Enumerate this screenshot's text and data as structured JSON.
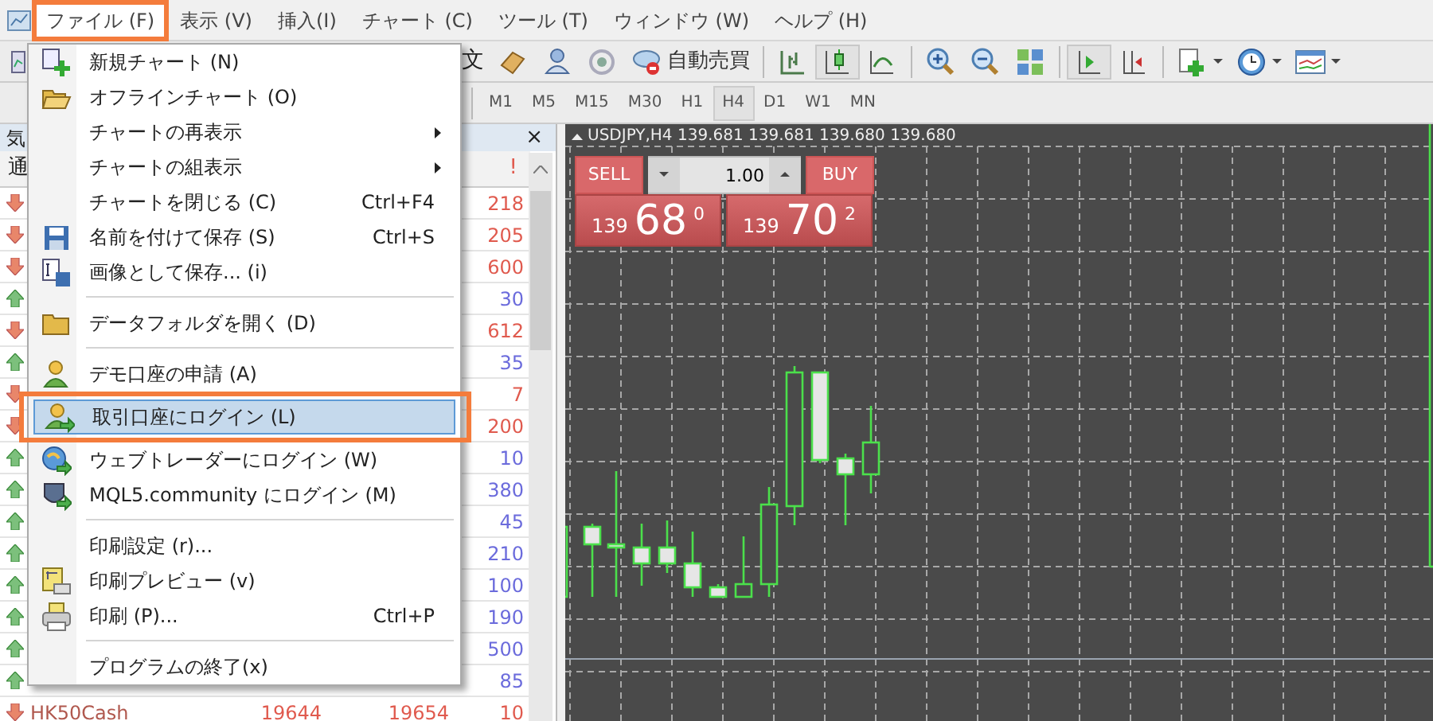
{
  "menubar": {
    "items": [
      {
        "label": "ファイル (F)",
        "selected": true,
        "highlighted": true
      },
      {
        "label": "表示 (V)",
        "selected": false,
        "highlighted": false
      },
      {
        "label": "挿入(I)",
        "selected": false,
        "highlighted": false
      },
      {
        "label": "チャート (C)",
        "selected": false,
        "highlighted": false
      },
      {
        "label": "ツール (T)",
        "selected": false,
        "highlighted": false
      },
      {
        "label": "ウィンドウ (W)",
        "selected": false,
        "highlighted": false
      },
      {
        "label": "ヘルプ (H)",
        "selected": false,
        "highlighted": false
      }
    ]
  },
  "toolbar": {
    "buttons": [
      {
        "kind": "text",
        "label": "文"
      },
      {
        "kind": "book",
        "selected": false
      },
      {
        "kind": "person",
        "selected": false
      },
      {
        "kind": "signal",
        "selected": false
      },
      {
        "kind": "robot",
        "label": "自動売買",
        "selected": false
      },
      {
        "kind": "separator"
      },
      {
        "kind": "bars",
        "selected": false
      },
      {
        "kind": "candles",
        "selected": true
      },
      {
        "kind": "line",
        "selected": false
      },
      {
        "kind": "separator"
      },
      {
        "kind": "zoomin",
        "selected": false
      },
      {
        "kind": "zoomout",
        "selected": false
      },
      {
        "kind": "tiles",
        "selected": false
      },
      {
        "kind": "separator"
      },
      {
        "kind": "autoscroll",
        "selected": true
      },
      {
        "kind": "shift",
        "selected": false
      },
      {
        "kind": "separator"
      },
      {
        "kind": "newchart",
        "selected": false
      },
      {
        "kind": "clock",
        "selected": false
      },
      {
        "kind": "indicators",
        "selected": false
      }
    ]
  },
  "timeframes": [
    {
      "label": "M1",
      "selected": false
    },
    {
      "label": "M5",
      "selected": false
    },
    {
      "label": "M15",
      "selected": false
    },
    {
      "label": "M30",
      "selected": false
    },
    {
      "label": "H1",
      "selected": false
    },
    {
      "label": "H4",
      "selected": true
    },
    {
      "label": "D1",
      "selected": false
    },
    {
      "label": "W1",
      "selected": false
    },
    {
      "label": "MN",
      "selected": false
    }
  ],
  "market_watch": {
    "title": "気",
    "close": "×",
    "columns": [
      "通",
      "!"
    ],
    "rows": [
      {
        "kind": "down",
        "spread": "218"
      },
      {
        "kind": "down",
        "spread": "205"
      },
      {
        "kind": "down",
        "spread": "600"
      },
      {
        "kind": "up",
        "spread": "30"
      },
      {
        "kind": "down",
        "spread": "612"
      },
      {
        "kind": "up",
        "spread": "35"
      },
      {
        "kind": "down",
        "spread": "7"
      },
      {
        "kind": "down",
        "spread": "200"
      },
      {
        "kind": "up",
        "spread": "10"
      },
      {
        "kind": "up",
        "spread": "380"
      },
      {
        "kind": "up",
        "spread": "45"
      },
      {
        "kind": "up",
        "spread": "210"
      },
      {
        "kind": "up",
        "spread": "100"
      },
      {
        "kind": "up",
        "spread": "190"
      },
      {
        "kind": "up",
        "spread": "500"
      },
      {
        "kind": "up",
        "spread": "85"
      },
      {
        "kind": "down",
        "symbol": "HK50Cash",
        "bid": "19644",
        "ask": "19654",
        "spread": "10"
      }
    ]
  },
  "chart": {
    "title": "USDJPY,H4  139.681 139.681 139.680 139.680",
    "trade_panel": {
      "sell_label": "SELL",
      "buy_label": "BUY",
      "lot": "1.00",
      "sell_price": {
        "prefix": "139",
        "main": "68",
        "sup": "0"
      },
      "buy_price": {
        "prefix": "139",
        "main": "70",
        "sup": "2"
      }
    }
  },
  "file_menu": {
    "items": [
      {
        "kind": "item",
        "label": "新規チャート (N)",
        "selected": false,
        "highlighted": false
      },
      {
        "kind": "item",
        "label": "オフラインチャート (O)",
        "selected": false,
        "highlighted": false
      },
      {
        "kind": "submenu",
        "label": "チャートの再表示",
        "selected": false,
        "highlighted": false
      },
      {
        "kind": "submenu",
        "label": "チャートの組表示",
        "selected": false,
        "highlighted": false
      },
      {
        "kind": "item",
        "label": "チャートを閉じる (C)",
        "shortcut": "Ctrl+F4",
        "selected": false,
        "highlighted": false
      },
      {
        "kind": "item",
        "label": "名前を付けて保存 (S)",
        "shortcut": "Ctrl+S",
        "selected": false,
        "highlighted": false
      },
      {
        "kind": "item",
        "label": "画像として保存... (i)",
        "selected": false,
        "highlighted": false
      },
      {
        "kind": "separator"
      },
      {
        "kind": "item",
        "label": "データフォルダを開く (D)",
        "selected": false,
        "highlighted": false
      },
      {
        "kind": "separator"
      },
      {
        "kind": "item",
        "label": "デモ口座の申請 (A)",
        "selected": false,
        "highlighted": false
      },
      {
        "kind": "item",
        "label": "取引口座にログイン (L)",
        "selected": true,
        "highlighted": true
      },
      {
        "kind": "item",
        "label": "ウェブトレーダーにログイン (W)",
        "selected": false,
        "highlighted": false
      },
      {
        "kind": "item",
        "label": "MQL5.community にログイン (M)",
        "selected": false,
        "highlighted": false
      },
      {
        "kind": "separator"
      },
      {
        "kind": "item",
        "label": "印刷設定 (r)...",
        "selected": false,
        "highlighted": false
      },
      {
        "kind": "item",
        "label": "印刷プレビュー (v)",
        "selected": false,
        "highlighted": false
      },
      {
        "kind": "item",
        "label": "印刷 (P)...",
        "shortcut": "Ctrl+P",
        "selected": false,
        "highlighted": false
      },
      {
        "kind": "separator"
      },
      {
        "kind": "item",
        "label": "プログラムの終了(x)",
        "selected": false,
        "highlighted": false
      }
    ]
  }
}
